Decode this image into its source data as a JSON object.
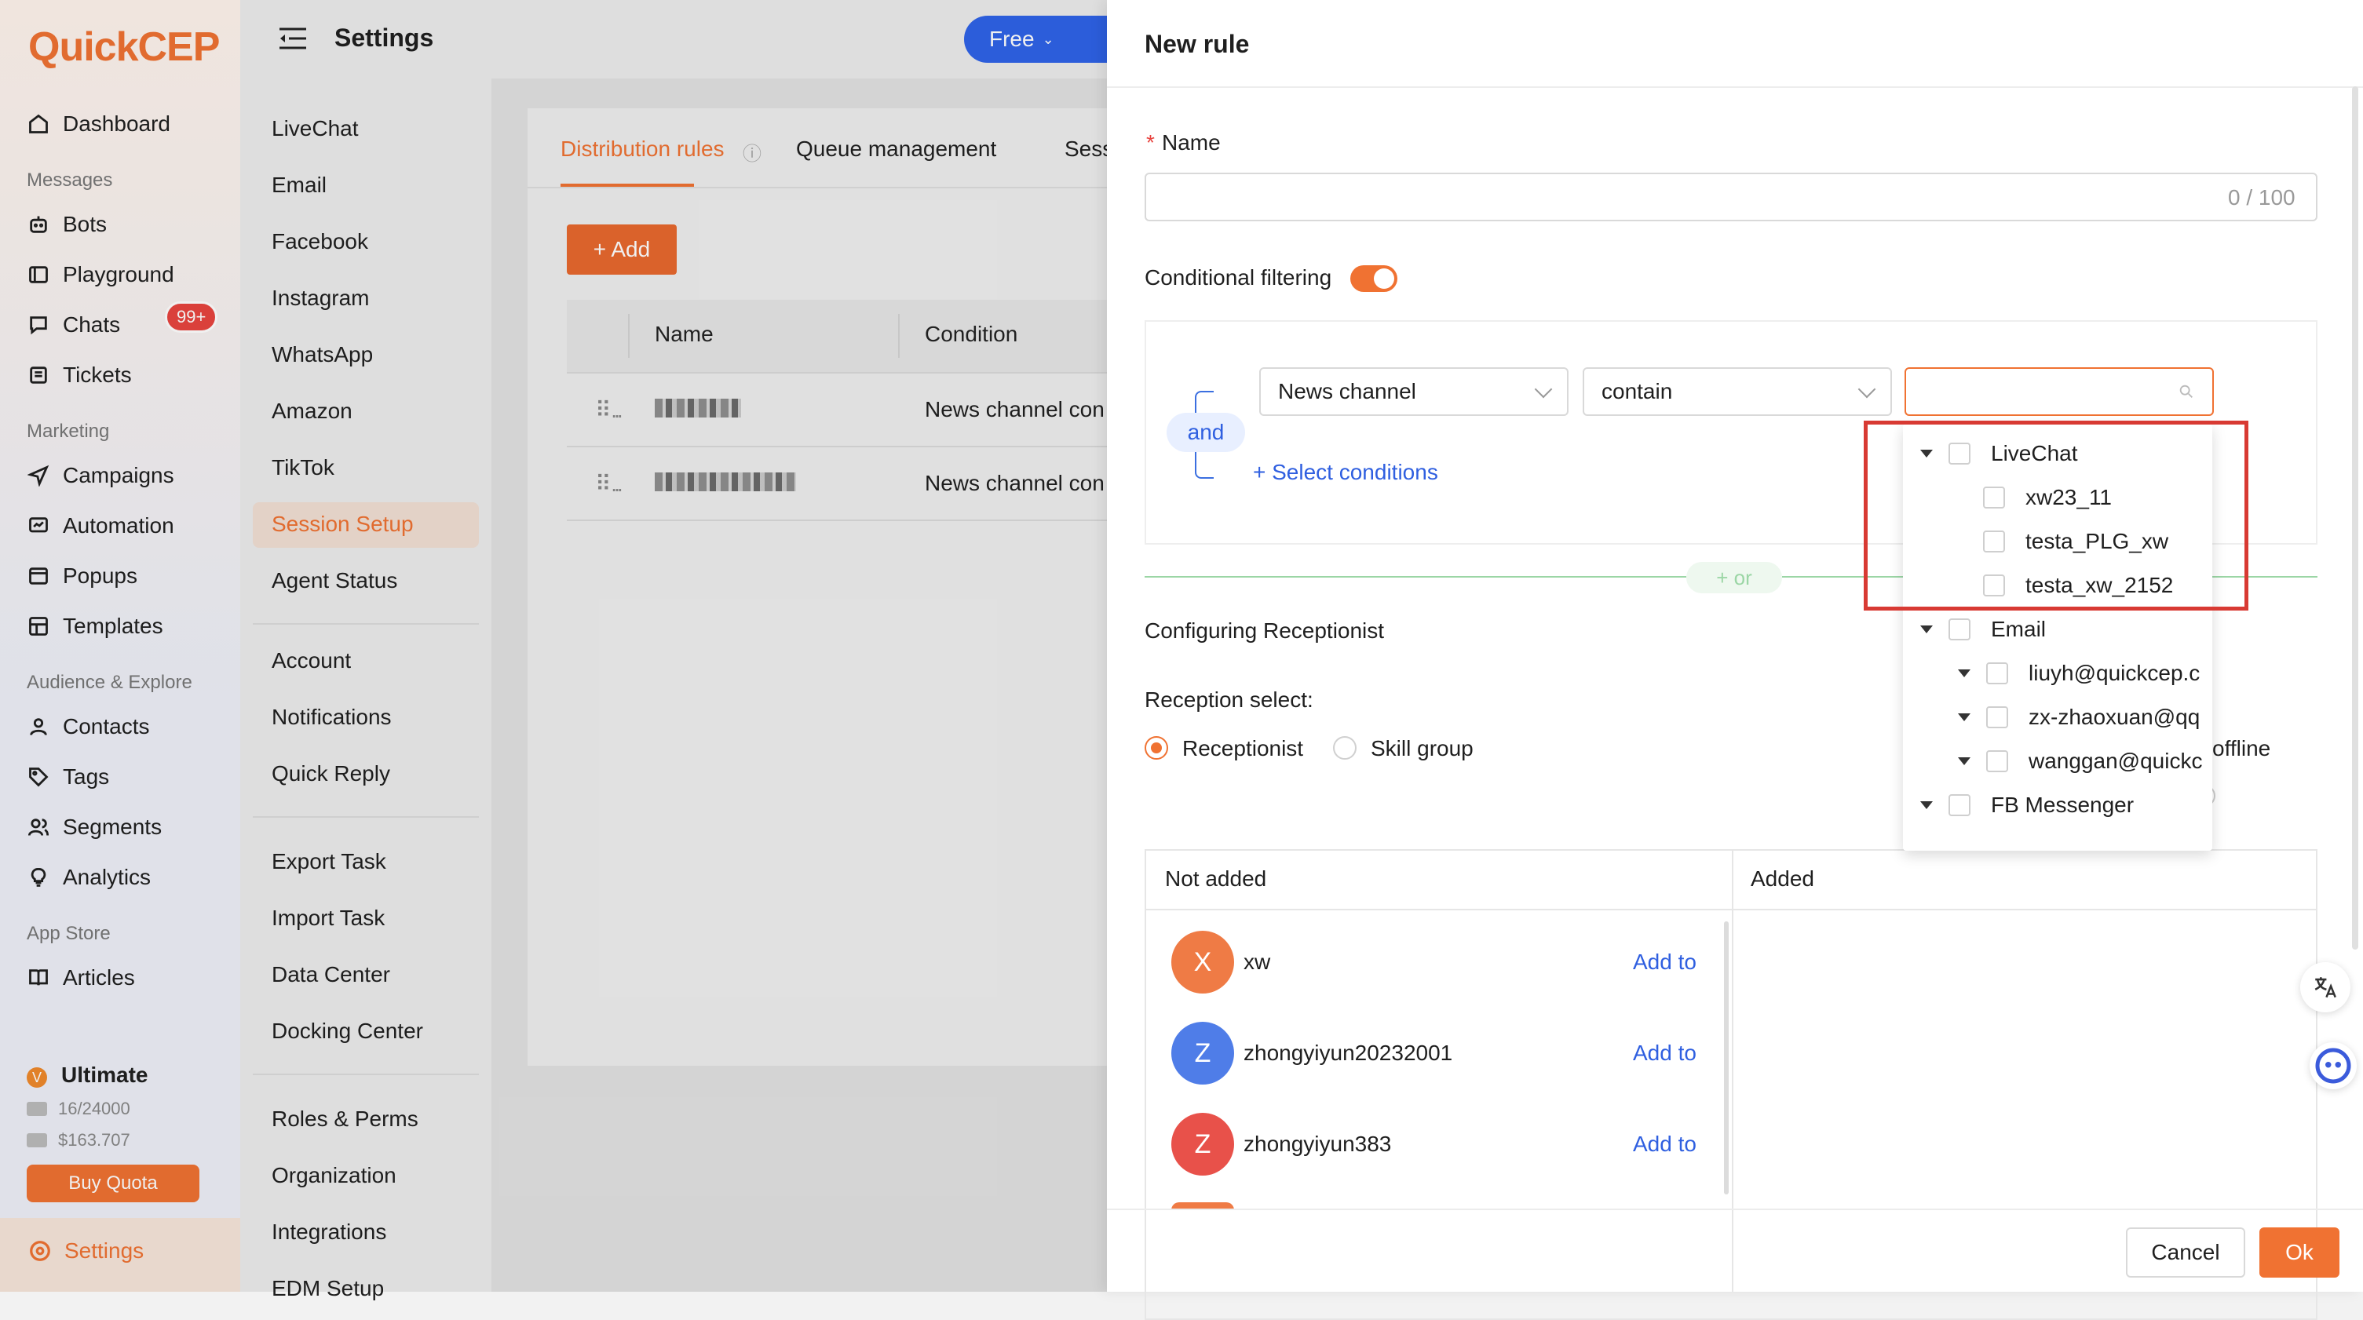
{
  "brand": {
    "logo_text": "QuickCEP"
  },
  "sidebar": {
    "items_top": [
      {
        "label": "Dashboard",
        "icon": "home-icon"
      }
    ],
    "sections": [
      {
        "label": "Messages",
        "items": [
          {
            "label": "Bots",
            "icon": "bot-icon"
          },
          {
            "label": "Playground",
            "icon": "playground-icon"
          },
          {
            "label": "Chats",
            "icon": "chat-icon",
            "badge": "99+"
          },
          {
            "label": "Tickets",
            "icon": "ticket-icon"
          }
        ]
      },
      {
        "label": "Marketing",
        "items": [
          {
            "label": "Campaigns",
            "icon": "send-icon"
          },
          {
            "label": "Automation",
            "icon": "automation-icon"
          },
          {
            "label": "Popups",
            "icon": "popup-icon"
          },
          {
            "label": "Templates",
            "icon": "template-icon"
          }
        ]
      },
      {
        "label": "Audience & Explore",
        "items": [
          {
            "label": "Contacts",
            "icon": "user-icon"
          },
          {
            "label": "Tags",
            "icon": "tag-icon"
          },
          {
            "label": "Segments",
            "icon": "segments-icon"
          },
          {
            "label": "Analytics",
            "icon": "bulb-icon"
          }
        ]
      },
      {
        "label": "App Store",
        "items": [
          {
            "label": "Articles",
            "icon": "book-icon"
          }
        ]
      }
    ],
    "plan": {
      "label": "Ultimate",
      "icon_letter": "V",
      "emails": "16/24000",
      "balance": "$163.707",
      "buy_label": "Buy Quota"
    },
    "settings_label": "Settings"
  },
  "header": {
    "title": "Settings",
    "plan_button": "Free"
  },
  "submenu": {
    "group1": [
      "LiveChat",
      "Email",
      "Facebook",
      "Instagram",
      "WhatsApp",
      "Amazon",
      "TikTok",
      "Session Setup",
      "Agent Status"
    ],
    "group2": [
      "Account",
      "Notifications",
      "Quick Reply"
    ],
    "group3": [
      "Export Task",
      "Import Task",
      "Data Center",
      "Docking Center"
    ],
    "group4": [
      "Roles & Perms",
      "Organization",
      "Integrations",
      "EDM Setup"
    ],
    "active": "Session Setup"
  },
  "main": {
    "tabs": [
      {
        "label": "Distribution rules"
      },
      {
        "label": "Queue management"
      },
      {
        "label": "Sess"
      }
    ],
    "add_button": "+ Add",
    "columns": [
      "Name",
      "Condition"
    ],
    "rows": [
      {
        "condition": "News channel con"
      },
      {
        "condition": "News channel con"
      }
    ],
    "row_handle": "⠿ ..."
  },
  "drawer": {
    "title": "New rule",
    "name_label": "Name",
    "required_mark": "*",
    "name_value": "",
    "name_counter": "0 / 100",
    "cond_filter_label": "Conditional filtering",
    "cond_filter_on": true,
    "and_label": "and",
    "field_select": "News channel",
    "operator_select": "contain",
    "value_search": "",
    "select_conditions": "+ Select conditions",
    "or_label": "+ or",
    "config_label": "Configuring Receptionist",
    "reception_label": "Reception select:",
    "radio_receptionist": "Receptionist",
    "radio_skill": "Skill group",
    "offline_text": "offline",
    "not_added": "Not added",
    "added": "Added",
    "users": [
      {
        "initial": "X",
        "name": "xw",
        "color": "#ef7b45",
        "action": "Add to"
      },
      {
        "initial": "Z",
        "name": "zhongyiyun20232001",
        "color": "#4f7de8",
        "action": "Add to"
      },
      {
        "initial": "Z",
        "name": "zhongyiyun383",
        "color": "#e8514a",
        "action": "Add to"
      }
    ],
    "cancel": "Cancel",
    "ok": "Ok"
  },
  "dropdown": {
    "tree": [
      {
        "label": "LiveChat",
        "level": 0,
        "caret": true,
        "children": [
          "xw23_11",
          "testa_PLG_xw",
          "testa_xw_2152"
        ]
      },
      {
        "label": "Email",
        "level": 0,
        "caret": true,
        "children": [
          "liuyh@quickcep.c",
          "zx-zhaoxuan@qq",
          "wanggan@quickc"
        ]
      },
      {
        "label": "FB Messenger",
        "level": 0,
        "caret": true,
        "children": []
      }
    ]
  },
  "floating": {
    "translate_icon": "translate-icon",
    "assistant_icon": "assistant-icon"
  }
}
